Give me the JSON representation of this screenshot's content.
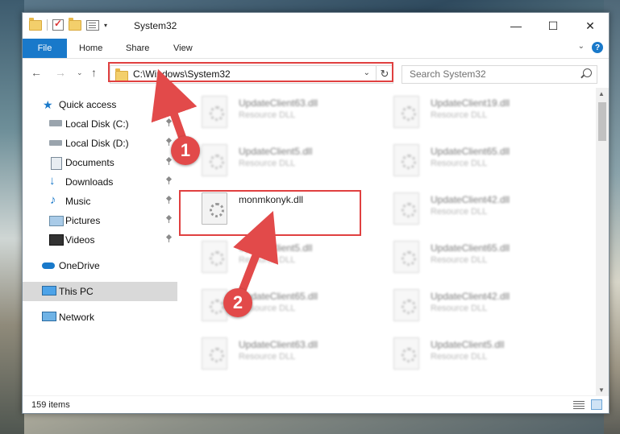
{
  "window": {
    "title": "System32"
  },
  "window_controls": {
    "minimize": "—",
    "maximize": "☐",
    "close": "✕"
  },
  "ribbon": {
    "file": "File",
    "home": "Home",
    "share": "Share",
    "view": "View",
    "expand": "⌄",
    "help": "?"
  },
  "address_bar": {
    "path": "C:\\Windows\\System32"
  },
  "search": {
    "placeholder": "Search System32"
  },
  "sidebar": {
    "items": [
      {
        "label": "Quick access"
      },
      {
        "label": "Local Disk (C:)"
      },
      {
        "label": "Local Disk (D:)"
      },
      {
        "label": "Documents"
      },
      {
        "label": "Downloads"
      },
      {
        "label": "Music"
      },
      {
        "label": "Pictures"
      },
      {
        "label": "Videos"
      },
      {
        "label": "OneDrive"
      },
      {
        "label": "This PC"
      },
      {
        "label": "Network"
      }
    ]
  },
  "files": {
    "highlighted": {
      "name": "monmkonyk.dll"
    },
    "items": [
      {
        "name": "UpdateClient63.dll",
        "type": "Resource DLL"
      },
      {
        "name": "UpdateClient19.dll",
        "type": "Resource DLL"
      },
      {
        "name": "UpdateClient5.dll",
        "type": "Resource DLL"
      },
      {
        "name": "UpdateClient65.dll",
        "type": "Resource DLL"
      },
      {
        "name": "UpdateClient42.dll",
        "type": "Resource DLL"
      },
      {
        "name": "UpdateClient5.dll",
        "type": "Resource DLL"
      },
      {
        "name": "UpdateClient65.dll",
        "type": "Resource DLL"
      },
      {
        "name": "UpdateClient65.dll",
        "type": "Resource DLL"
      },
      {
        "name": "UpdateClient42.dll",
        "type": "Resource DLL"
      },
      {
        "name": "UpdateClient63.dll",
        "type": "Resource DLL"
      },
      {
        "name": "UpdateClient5.dll",
        "type": "Resource DLL"
      }
    ]
  },
  "status": {
    "count": "159 items"
  },
  "annotations": {
    "step1": "1",
    "step2": "2"
  },
  "colors": {
    "accent": "#1979ca",
    "highlight": "#e04040"
  }
}
